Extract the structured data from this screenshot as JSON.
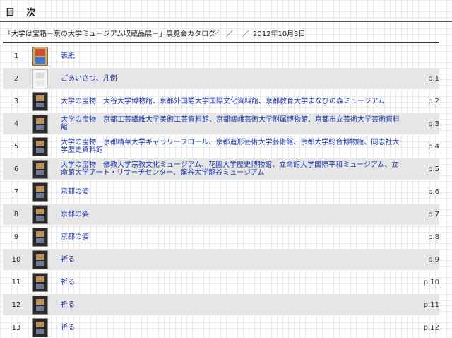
{
  "header": {
    "title": "目 次"
  },
  "catalog": {
    "title": "「大学は宝箱－京の大学ミュージアム収蔵品展－」展覧会カタログ",
    "sep1": "／",
    "sep2": "／",
    "sep3": "／",
    "date": "2012年10月3日"
  },
  "toc": [
    {
      "num": "1",
      "label": "表紙",
      "page": ""
    },
    {
      "num": "2",
      "label": "ごあいさつ、凡例",
      "page": "p.1"
    },
    {
      "num": "3",
      "label": "大学の宝物　大谷大学博物館、京都外国語大学国際文化資料館、京都教育大学まなびの森ミュージアム",
      "page": "p.2"
    },
    {
      "num": "4",
      "label": "大学の宝物　京都工芸繊維大学美術工芸資料館、京都嵯峨芸術大学附属博物館、京都市立芸術大学芸術資料館",
      "page": "p.3"
    },
    {
      "num": "5",
      "label": "大学の宝物　京都精華大学ギャラリーフロール、京都造形芸術大学芸術館、京都大学総合博物館、同志社大学歴史資料館",
      "page": "p.4"
    },
    {
      "num": "6",
      "label": "大学の宝物　佛教大学宗教文化ミュージアム、花園大学歴史博物館、立命館大学国際平和ミュージアム、立命館大学アート・リサーチセンター、龍谷大学龍谷ミュージアム",
      "page": "p.5"
    },
    {
      "num": "7",
      "label": "京都の姿",
      "page": "p.6"
    },
    {
      "num": "8",
      "label": "京都の姿",
      "page": "p.7"
    },
    {
      "num": "9",
      "label": "京都の姿",
      "page": "p.8"
    },
    {
      "num": "10",
      "label": "祈る",
      "page": "p.9"
    },
    {
      "num": "11",
      "label": "祈る",
      "page": "p.10"
    },
    {
      "num": "12",
      "label": "祈る",
      "page": "p.11"
    },
    {
      "num": "13",
      "label": "祈る",
      "page": "p.12"
    }
  ]
}
